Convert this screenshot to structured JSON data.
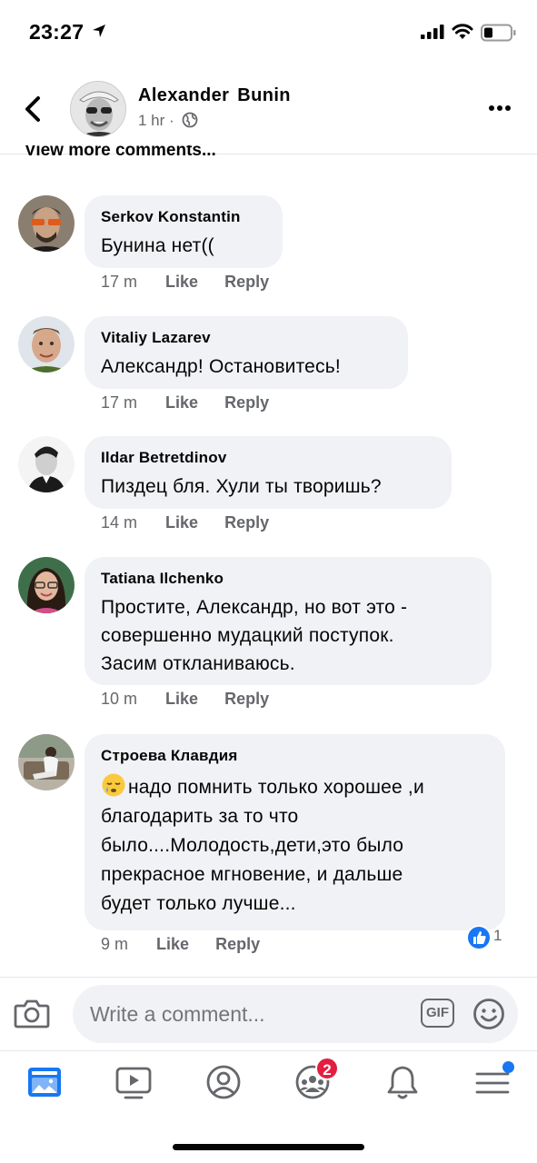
{
  "status_bar": {
    "time": "23:27"
  },
  "header": {
    "name": "Alexander  Bunin",
    "meta": "1 hr ·",
    "avatar": "author-photo"
  },
  "view_more": "View more comments...",
  "comments": [
    {
      "author": "Serkov Konstantin",
      "text": "Бунина нет((",
      "time": "17 m",
      "like": "Like",
      "reply": "Reply"
    },
    {
      "author": "Vitaliy Lazarev",
      "text": "Александр! Остановитесь!",
      "time": "17 m",
      "like": "Like",
      "reply": "Reply"
    },
    {
      "author": "Ildar Betretdinov",
      "text": "Пиздец бля. Хули ты творишь?",
      "time": "14 m",
      "like": "Like",
      "reply": "Reply"
    },
    {
      "author": "Tatiana Ilchenko",
      "line1": "Простите, Александр, но вот это -",
      "line2": "совершенно мудацкий поступок.",
      "line3": "Засим откланиваюсь.",
      "time": "10 m",
      "like": "Like",
      "reply": "Reply"
    },
    {
      "author": "Строева Клавдия",
      "line1": "надо помнить только хорошее ,и",
      "line2": "благодарить за то что",
      "line3": "было....Молодость,дети,это было",
      "line4": "прекрасное мгновение, и дальше",
      "line5": "будет только лучше...",
      "time": "9 m",
      "like": "Like",
      "reply": "Reply",
      "reaction_count": "1",
      "emoji": "sleepy-face"
    }
  ],
  "composer": {
    "placeholder": "Write a comment...",
    "gif_label": "GIF"
  },
  "tabbar": {
    "items": [
      "news-feed-icon",
      "watch-icon",
      "profile-icon",
      "groups-icon",
      "notifications-icon",
      "menu-icon"
    ],
    "groups_badge": "2"
  },
  "colors": {
    "accent": "#1877f2",
    "badge": "#e41e3f",
    "bubble": "#f0f2f5",
    "secondary_text": "#65676b"
  }
}
